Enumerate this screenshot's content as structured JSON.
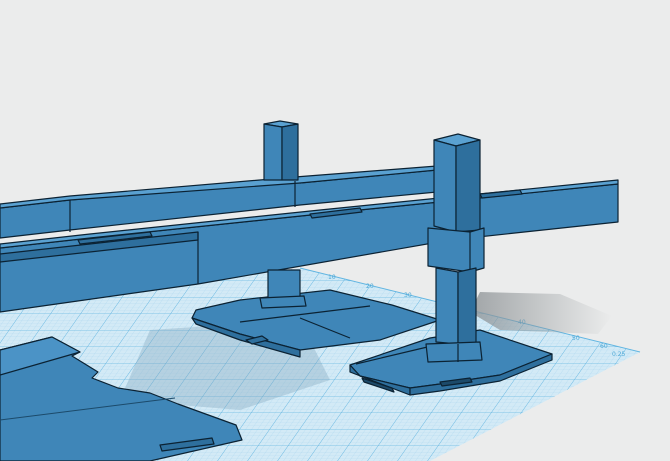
{
  "app": {
    "canvas_background": "#ebecec"
  },
  "colors": {
    "model_face": "#3f86b8",
    "model_top": "#4b93c6",
    "model_dark": "#2e6f9d",
    "edge": "#0b2233",
    "grid_fill": "#d3eaf6",
    "grid_line_minor": "#a9d6ee",
    "grid_line_major": "#61b5e1",
    "shadow": "#a9aeb1"
  },
  "workplane": {
    "axis_labels": [
      "10",
      "20",
      "30",
      "40",
      "50",
      "60"
    ],
    "corner_label": "0.25"
  },
  "scene": {
    "objects": [
      {
        "name": "rail-beam-back",
        "type": "rail"
      },
      {
        "name": "rail-beam-front",
        "type": "rail"
      },
      {
        "name": "support-post-left",
        "type": "post"
      },
      {
        "name": "support-post-right",
        "type": "post"
      },
      {
        "name": "base-plate-center",
        "type": "plate"
      },
      {
        "name": "base-plate-right",
        "type": "plate"
      },
      {
        "name": "base-plate-front-left",
        "type": "plate"
      }
    ]
  }
}
